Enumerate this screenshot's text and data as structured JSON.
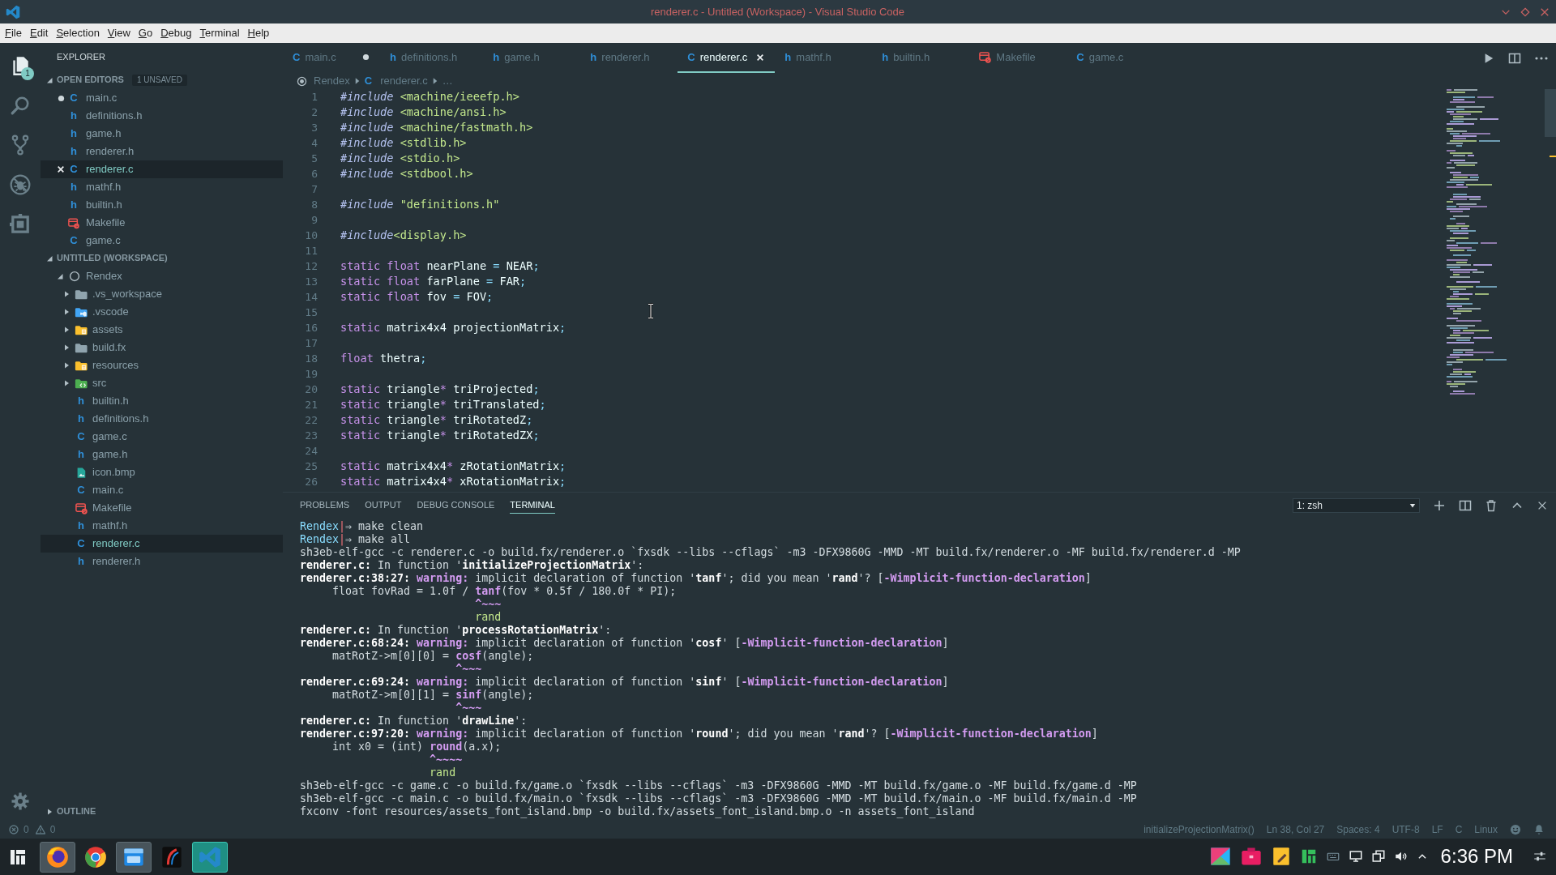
{
  "window": {
    "title": "renderer.c - Untitled (Workspace) - Visual Studio Code"
  },
  "menu": [
    "File",
    "Edit",
    "Selection",
    "View",
    "Go",
    "Debug",
    "Terminal",
    "Help"
  ],
  "activity_bar": [
    {
      "kind": "explorer",
      "selected": true,
      "badge": "1"
    },
    {
      "kind": "search",
      "selected": false
    },
    {
      "kind": "scm",
      "selected": false
    },
    {
      "kind": "debug",
      "selected": false
    },
    {
      "kind": "extensions",
      "selected": false
    }
  ],
  "sidebar": {
    "title": "EXPLORER",
    "open_editors": {
      "title": "OPEN EDITORS",
      "badge": "1 UNSAVED",
      "expanded": true,
      "items": [
        {
          "label": "main.c",
          "kind": "source",
          "glyph": "C",
          "dirty": true,
          "selected": false
        },
        {
          "label": "definitions.h",
          "kind": "source",
          "glyph": "h",
          "dirty": false,
          "selected": false
        },
        {
          "label": "game.h",
          "kind": "source",
          "glyph": "h",
          "dirty": false,
          "selected": false
        },
        {
          "label": "renderer.h",
          "kind": "source",
          "glyph": "h",
          "dirty": false,
          "selected": false
        },
        {
          "label": "renderer.c",
          "kind": "source",
          "glyph": "C",
          "dirty": false,
          "selected": true
        },
        {
          "label": "mathf.h",
          "kind": "source",
          "glyph": "h",
          "dirty": false,
          "selected": false
        },
        {
          "label": "builtin.h",
          "kind": "source",
          "glyph": "h",
          "dirty": false,
          "selected": false
        },
        {
          "label": "Makefile",
          "kind": "makefile",
          "dirty": false,
          "selected": false
        },
        {
          "label": "game.c",
          "kind": "source",
          "glyph": "C",
          "dirty": false,
          "selected": false
        }
      ]
    },
    "workspace": {
      "title": "UNTITLED (WORKSPACE)",
      "expanded": true,
      "tree": [
        {
          "label": "Rendex",
          "kind": "root",
          "expanded": true,
          "selected": false,
          "children": [
            {
              "label": ".vs_workspace",
              "kind": "plainfolder",
              "expanded": false,
              "selected": false
            },
            {
              "label": ".vscode",
              "kind": "configfolder",
              "expanded": false,
              "selected": false
            },
            {
              "label": "assets",
              "kind": "assetfolder",
              "expanded": false,
              "selected": false
            },
            {
              "label": "build.fx",
              "kind": "plainfolder",
              "expanded": false,
              "selected": false
            },
            {
              "label": "resources",
              "kind": "assetfolder",
              "expanded": false,
              "selected": false
            },
            {
              "label": "src",
              "kind": "sourcefolder",
              "expanded": false,
              "selected": false
            },
            {
              "label": "builtin.h",
              "kind": "source",
              "glyph": "h",
              "selected": false
            },
            {
              "label": "definitions.h",
              "kind": "source",
              "glyph": "h",
              "selected": false
            },
            {
              "label": "game.c",
              "kind": "source",
              "glyph": "C",
              "selected": false
            },
            {
              "label": "game.h",
              "kind": "source",
              "glyph": "h",
              "selected": false
            },
            {
              "label": "icon.bmp",
              "kind": "image",
              "selected": false
            },
            {
              "label": "main.c",
              "kind": "source",
              "glyph": "C",
              "selected": false
            },
            {
              "label": "Makefile",
              "kind": "makefile",
              "selected": false
            },
            {
              "label": "mathf.h",
              "kind": "source",
              "glyph": "h",
              "selected": false
            },
            {
              "label": "renderer.c",
              "kind": "source",
              "glyph": "C",
              "selected": true
            },
            {
              "label": "renderer.h",
              "kind": "source",
              "glyph": "h",
              "selected": false
            }
          ]
        }
      ]
    },
    "outline": {
      "title": "OUTLINE",
      "expanded": false
    }
  },
  "tabs": [
    {
      "label": "main.c",
      "kind": "source",
      "glyph": "C",
      "selected": false,
      "dirty": true
    },
    {
      "label": "definitions.h",
      "kind": "source",
      "glyph": "h",
      "selected": false,
      "dirty": false
    },
    {
      "label": "game.h",
      "kind": "source",
      "glyph": "h",
      "selected": false,
      "dirty": false
    },
    {
      "label": "renderer.h",
      "kind": "source",
      "glyph": "h",
      "selected": false,
      "dirty": false
    },
    {
      "label": "renderer.c",
      "kind": "source",
      "glyph": "C",
      "selected": true,
      "dirty": false
    },
    {
      "label": "mathf.h",
      "kind": "source",
      "glyph": "h",
      "selected": false,
      "dirty": false
    },
    {
      "label": "builtin.h",
      "kind": "source",
      "glyph": "h",
      "selected": false,
      "dirty": false
    },
    {
      "label": "Makefile",
      "kind": "makefile",
      "selected": false,
      "dirty": false
    },
    {
      "label": "game.c",
      "kind": "source",
      "glyph": "C",
      "selected": false,
      "dirty": false
    }
  ],
  "breadcrumbs": [
    {
      "label": "Rendex",
      "kind": "root"
    },
    {
      "label": "renderer.c",
      "kind": "source",
      "glyph": "C"
    },
    {
      "label": "…",
      "kind": "more"
    }
  ],
  "editor": {
    "lines": [
      {
        "number": "1",
        "tokens": [
          {
            "text": "#include",
            "kind": "directive"
          },
          {
            "text": " <machine/ieeefp.h>",
            "kind": "string"
          }
        ]
      },
      {
        "number": "2",
        "tokens": [
          {
            "text": "#include",
            "kind": "directive"
          },
          {
            "text": " <machine/ansi.h>",
            "kind": "string"
          }
        ]
      },
      {
        "number": "3",
        "tokens": [
          {
            "text": "#include",
            "kind": "directive"
          },
          {
            "text": " <machine/fastmath.h>",
            "kind": "string"
          }
        ]
      },
      {
        "number": "4",
        "tokens": [
          {
            "text": "#include",
            "kind": "directive"
          },
          {
            "text": " <stdlib.h>",
            "kind": "string"
          }
        ]
      },
      {
        "number": "5",
        "tokens": [
          {
            "text": "#include",
            "kind": "directive"
          },
          {
            "text": " <stdio.h>",
            "kind": "string"
          }
        ]
      },
      {
        "number": "6",
        "tokens": [
          {
            "text": "#include",
            "kind": "directive"
          },
          {
            "text": " <stdbool.h>",
            "kind": "string"
          }
        ]
      },
      {
        "number": "7"
      },
      {
        "number": "8",
        "tokens": [
          {
            "text": "#include",
            "kind": "directive"
          },
          {
            "text": " \"definitions.h\"",
            "kind": "string"
          }
        ]
      },
      {
        "number": "9"
      },
      {
        "number": "10",
        "tokens": [
          {
            "text": "#include",
            "kind": "directive"
          },
          {
            "text": "<display.h>",
            "kind": "string"
          }
        ]
      },
      {
        "number": "11"
      },
      {
        "number": "12",
        "tokens": [
          {
            "text": "static float ",
            "kind": "keyword"
          },
          {
            "text": "nearPlane ",
            "kind": "identifier"
          },
          {
            "text": "= ",
            "kind": "punctuation"
          },
          {
            "text": "NEAR",
            "kind": "identifier"
          },
          {
            "text": ";",
            "kind": "punctuation"
          }
        ]
      },
      {
        "number": "13",
        "tokens": [
          {
            "text": "static float ",
            "kind": "keyword"
          },
          {
            "text": "farPlane ",
            "kind": "identifier"
          },
          {
            "text": "= ",
            "kind": "punctuation"
          },
          {
            "text": "FAR",
            "kind": "identifier"
          },
          {
            "text": ";",
            "kind": "punctuation"
          }
        ]
      },
      {
        "number": "14",
        "tokens": [
          {
            "text": "static float ",
            "kind": "keyword"
          },
          {
            "text": "fov ",
            "kind": "identifier"
          },
          {
            "text": "= ",
            "kind": "punctuation"
          },
          {
            "text": "FOV",
            "kind": "identifier"
          },
          {
            "text": ";",
            "kind": "punctuation"
          }
        ]
      },
      {
        "number": "15"
      },
      {
        "number": "16",
        "tokens": [
          {
            "text": "static ",
            "kind": "keyword"
          },
          {
            "text": "matrix4x4 projectionMatrix",
            "kind": "identifier"
          },
          {
            "text": ";",
            "kind": "punctuation"
          }
        ]
      },
      {
        "number": "17"
      },
      {
        "number": "18",
        "tokens": [
          {
            "text": "float ",
            "kind": "keyword"
          },
          {
            "text": "thetra",
            "kind": "identifier"
          },
          {
            "text": ";",
            "kind": "punctuation"
          }
        ]
      },
      {
        "number": "19"
      },
      {
        "number": "20",
        "tokens": [
          {
            "text": "static ",
            "kind": "keyword"
          },
          {
            "text": "triangle",
            "kind": "identifier"
          },
          {
            "text": "* ",
            "kind": "operator"
          },
          {
            "text": "triProjected",
            "kind": "identifier"
          },
          {
            "text": ";",
            "kind": "punctuation"
          }
        ]
      },
      {
        "number": "21",
        "tokens": [
          {
            "text": "static ",
            "kind": "keyword"
          },
          {
            "text": "triangle",
            "kind": "identifier"
          },
          {
            "text": "* ",
            "kind": "operator"
          },
          {
            "text": "triTranslated",
            "kind": "identifier"
          },
          {
            "text": ";",
            "kind": "punctuation"
          }
        ]
      },
      {
        "number": "22",
        "tokens": [
          {
            "text": "static ",
            "kind": "keyword"
          },
          {
            "text": "triangle",
            "kind": "identifier"
          },
          {
            "text": "* ",
            "kind": "operator"
          },
          {
            "text": "triRotatedZ",
            "kind": "identifier"
          },
          {
            "text": ";",
            "kind": "punctuation"
          }
        ]
      },
      {
        "number": "23",
        "tokens": [
          {
            "text": "static ",
            "kind": "keyword"
          },
          {
            "text": "triangle",
            "kind": "identifier"
          },
          {
            "text": "* ",
            "kind": "operator"
          },
          {
            "text": "triRotatedZX",
            "kind": "identifier"
          },
          {
            "text": ";",
            "kind": "punctuation"
          }
        ]
      },
      {
        "number": "24"
      },
      {
        "number": "25",
        "tokens": [
          {
            "text": "static ",
            "kind": "keyword"
          },
          {
            "text": "matrix4x4",
            "kind": "identifier"
          },
          {
            "text": "* ",
            "kind": "operator"
          },
          {
            "text": "zRotationMatrix",
            "kind": "identifier"
          },
          {
            "text": ";",
            "kind": "punctuation"
          }
        ]
      },
      {
        "number": "26",
        "tokens": [
          {
            "text": "static ",
            "kind": "keyword"
          },
          {
            "text": "matrix4x4",
            "kind": "identifier"
          },
          {
            "text": "* ",
            "kind": "operator"
          },
          {
            "text": "xRotationMatrix",
            "kind": "identifier"
          },
          {
            "text": ";",
            "kind": "punctuation"
          }
        ]
      }
    ]
  },
  "panel": {
    "tabs": [
      {
        "label": "PROBLEMS",
        "selected": false
      },
      {
        "label": "OUTPUT",
        "selected": false
      },
      {
        "label": "DEBUG CONSOLE",
        "selected": false
      },
      {
        "label": "TERMINAL",
        "selected": true
      }
    ],
    "terminal_dropdown": {
      "value": "1: zsh"
    },
    "terminal": [
      {
        "segments": [
          {
            "text": "Rendex",
            "kind": "prompt"
          },
          {
            "text": "|",
            "kind": "separator"
          },
          {
            "text": "⇒ make clean",
            "kind": "plain"
          }
        ]
      },
      {
        "segments": [
          {
            "text": "Rendex",
            "kind": "prompt"
          },
          {
            "text": "|",
            "kind": "separator"
          },
          {
            "text": "⇒ make all",
            "kind": "plain"
          }
        ]
      },
      {
        "segments": [
          {
            "text": "sh3eb-elf-gcc -c renderer.c -o build.fx/renderer.o `fxsdk --libs --cflags` -m3 -DFX9860G -MMD -MT build.fx/renderer.o -MF build.fx/renderer.d -MP",
            "kind": "plain"
          }
        ]
      },
      {
        "segments": [
          {
            "text": "renderer.c:",
            "kind": "bold"
          },
          {
            "text": " In function '",
            "kind": "plain"
          },
          {
            "text": "initializeProjectionMatrix",
            "kind": "bold"
          },
          {
            "text": "':",
            "kind": "plain"
          }
        ]
      },
      {
        "segments": [
          {
            "text": "renderer.c:38:27: ",
            "kind": "bold"
          },
          {
            "text": "warning:",
            "kind": "accent"
          },
          {
            "text": " implicit declaration of function '",
            "kind": "plain"
          },
          {
            "text": "tanf",
            "kind": "bold"
          },
          {
            "text": "'; did you mean '",
            "kind": "plain"
          },
          {
            "text": "rand",
            "kind": "bold"
          },
          {
            "text": "'? [",
            "kind": "plain"
          },
          {
            "text": "-Wimplicit-function-declaration",
            "kind": "accent"
          },
          {
            "text": "]",
            "kind": "plain"
          }
        ]
      },
      {
        "segments": [
          {
            "text": "     float fovRad = 1.0f / ",
            "kind": "plain"
          },
          {
            "text": "tanf",
            "kind": "accent"
          },
          {
            "text": "(fov * 0.5f / 180.0f * PI);",
            "kind": "plain"
          }
        ]
      },
      {
        "segments": [
          {
            "text": "                           ^~~~",
            "kind": "accent"
          }
        ]
      },
      {
        "segments": [
          {
            "text": "                           rand",
            "kind": "fix"
          }
        ]
      },
      {
        "segments": [
          {
            "text": "renderer.c:",
            "kind": "bold"
          },
          {
            "text": " In function '",
            "kind": "plain"
          },
          {
            "text": "processRotationMatrix",
            "kind": "bold"
          },
          {
            "text": "':",
            "kind": "plain"
          }
        ]
      },
      {
        "segments": [
          {
            "text": "renderer.c:68:24: ",
            "kind": "bold"
          },
          {
            "text": "warning:",
            "kind": "accent"
          },
          {
            "text": " implicit declaration of function '",
            "kind": "plain"
          },
          {
            "text": "cosf",
            "kind": "bold"
          },
          {
            "text": "' [",
            "kind": "plain"
          },
          {
            "text": "-Wimplicit-function-declaration",
            "kind": "accent"
          },
          {
            "text": "]",
            "kind": "plain"
          }
        ]
      },
      {
        "segments": [
          {
            "text": "     matRotZ->m[0][0] = ",
            "kind": "plain"
          },
          {
            "text": "cosf",
            "kind": "accent"
          },
          {
            "text": "(angle);",
            "kind": "plain"
          }
        ]
      },
      {
        "segments": [
          {
            "text": "                        ^~~~",
            "kind": "accent"
          }
        ]
      },
      {
        "segments": [
          {
            "text": "renderer.c:69:24: ",
            "kind": "bold"
          },
          {
            "text": "warning:",
            "kind": "accent"
          },
          {
            "text": " implicit declaration of function '",
            "kind": "plain"
          },
          {
            "text": "sinf",
            "kind": "bold"
          },
          {
            "text": "' [",
            "kind": "plain"
          },
          {
            "text": "-Wimplicit-function-declaration",
            "kind": "accent"
          },
          {
            "text": "]",
            "kind": "plain"
          }
        ]
      },
      {
        "segments": [
          {
            "text": "     matRotZ->m[0][1] = ",
            "kind": "plain"
          },
          {
            "text": "sinf",
            "kind": "accent"
          },
          {
            "text": "(angle);",
            "kind": "plain"
          }
        ]
      },
      {
        "segments": [
          {
            "text": "                        ^~~~",
            "kind": "accent"
          }
        ]
      },
      {
        "segments": [
          {
            "text": "renderer.c:",
            "kind": "bold"
          },
          {
            "text": " In function '",
            "kind": "plain"
          },
          {
            "text": "drawLine",
            "kind": "bold"
          },
          {
            "text": "':",
            "kind": "plain"
          }
        ]
      },
      {
        "segments": [
          {
            "text": "renderer.c:97:20: ",
            "kind": "bold"
          },
          {
            "text": "warning:",
            "kind": "accent"
          },
          {
            "text": " implicit declaration of function '",
            "kind": "plain"
          },
          {
            "text": "round",
            "kind": "bold"
          },
          {
            "text": "'; did you mean '",
            "kind": "plain"
          },
          {
            "text": "rand",
            "kind": "bold"
          },
          {
            "text": "'? [",
            "kind": "plain"
          },
          {
            "text": "-Wimplicit-function-declaration",
            "kind": "accent"
          },
          {
            "text": "]",
            "kind": "plain"
          }
        ]
      },
      {
        "segments": [
          {
            "text": "     int x0 = (int) ",
            "kind": "plain"
          },
          {
            "text": "round",
            "kind": "accent"
          },
          {
            "text": "(a.x);",
            "kind": "plain"
          }
        ]
      },
      {
        "segments": [
          {
            "text": "                    ^~~~~",
            "kind": "accent"
          }
        ]
      },
      {
        "segments": [
          {
            "text": "                    rand",
            "kind": "fix"
          }
        ]
      },
      {
        "segments": [
          {
            "text": "sh3eb-elf-gcc -c game.c -o build.fx/game.o `fxsdk --libs --cflags` -m3 -DFX9860G -MMD -MT build.fx/game.o -MF build.fx/game.d -MP",
            "kind": "plain"
          }
        ]
      },
      {
        "segments": [
          {
            "text": "sh3eb-elf-gcc -c main.c -o build.fx/main.o `fxsdk --libs --cflags` -m3 -DFX9860G -MMD -MT build.fx/main.o -MF build.fx/main.d -MP",
            "kind": "plain"
          }
        ]
      },
      {
        "segments": [
          {
            "text": "fxconv -font resources/assets_font_island.bmp -o build.fx/assets_font_island.bmp.o -n assets_font_island",
            "kind": "plain"
          }
        ]
      }
    ]
  },
  "status_bar": {
    "errors": "0",
    "warnings": "0",
    "items": [
      "initializeProjectionMatrix()",
      "Ln 38, Col 27",
      "Spaces: 4",
      "UTF-8",
      "LF",
      "C",
      "Linux"
    ]
  },
  "taskbar": {
    "apps": [
      {
        "kind": "orb",
        "running": true,
        "selected": false
      },
      {
        "kind": "wheel",
        "running": false,
        "selected": false
      },
      {
        "kind": "folder",
        "running": true,
        "selected": false
      },
      {
        "kind": "curve",
        "running": false,
        "selected": false
      },
      {
        "kind": "ribbon",
        "running": true,
        "selected": true
      }
    ],
    "clock": "6:36 PM"
  }
}
